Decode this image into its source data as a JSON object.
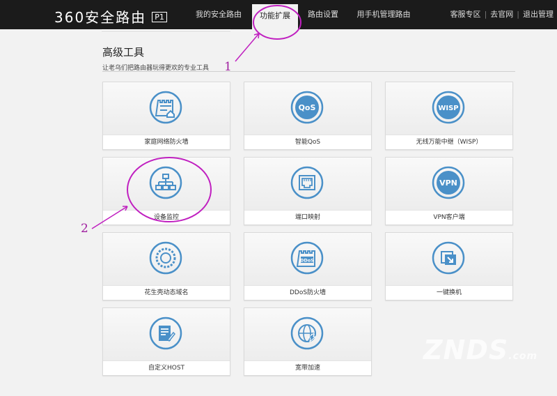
{
  "header": {
    "brand": "360安全路由",
    "model": "P1",
    "tabs": [
      {
        "label": "我的安全路由"
      },
      {
        "label": "功能扩展"
      },
      {
        "label": "路由设置"
      },
      {
        "label": "用手机管理路由"
      }
    ],
    "active_tab": "功能扩展",
    "links": [
      "客服专区",
      "去官网",
      "退出管理"
    ]
  },
  "section": {
    "title": "高级工具",
    "subtitle": "让老乌们把路由器玩得更欢的专业工具"
  },
  "tools": [
    {
      "label": "家庭网络防火墙",
      "icon": "home-firewall-icon"
    },
    {
      "label": "智能QoS",
      "icon": "qos-icon",
      "icon_text": "QoS"
    },
    {
      "label": "无线万能中继（WISP）",
      "icon": "wisp-icon",
      "icon_text": "WISP"
    },
    {
      "label": "设备监控",
      "icon": "device-monitor-icon"
    },
    {
      "label": "端口映射",
      "icon": "port-mapping-icon"
    },
    {
      "label": "VPN客户端",
      "icon": "vpn-icon",
      "icon_text": "VPN"
    },
    {
      "label": "花生壳动态域名",
      "icon": "ddns-icon"
    },
    {
      "label": "DDoS防火墙",
      "icon": "ddos-firewall-icon",
      "icon_text": "DDoS"
    },
    {
      "label": "一键换机",
      "icon": "one-click-switch-icon"
    },
    {
      "label": "自定义HOST",
      "icon": "custom-host-icon"
    },
    {
      "label": "宽带加速",
      "icon": "broadband-accel-icon"
    }
  ],
  "annotations": {
    "one": "1",
    "two": "2"
  },
  "watermark": {
    "text": "ZNDS",
    "suffix": ".com"
  },
  "colors": {
    "icon_blue": "#4a90c8",
    "annotation": "#c020c0",
    "topbar": "#1b1b1b"
  }
}
